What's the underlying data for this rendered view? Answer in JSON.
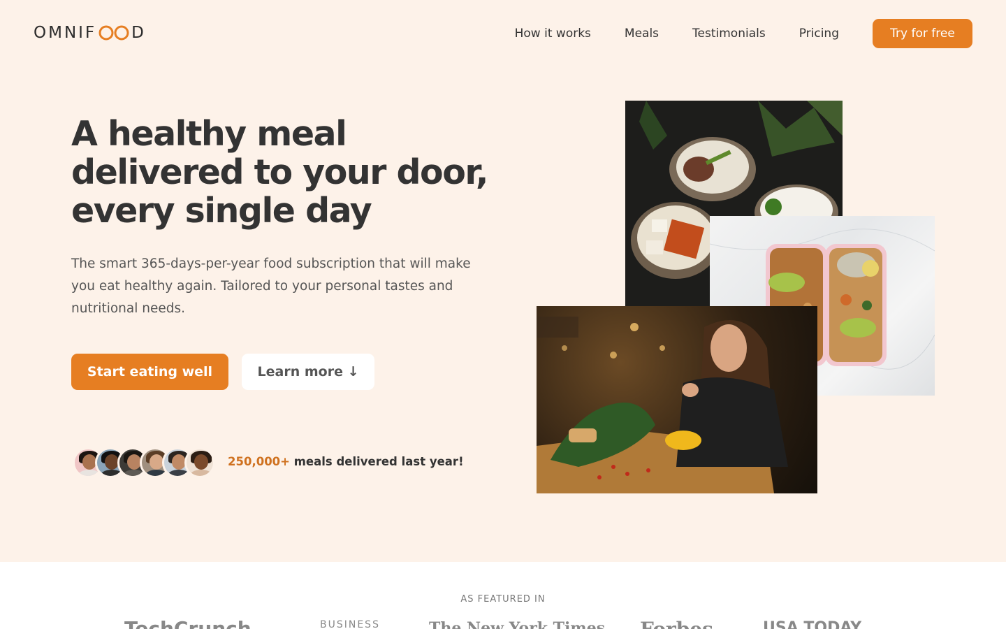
{
  "brand": {
    "name_left": "OMNIF",
    "name_right": "D",
    "accent": "#e67e22"
  },
  "nav": {
    "links": [
      "How it works",
      "Meals",
      "Testimonials",
      "Pricing"
    ],
    "cta": "Try for free"
  },
  "hero": {
    "headline": "A healthy meal delivered to your door, every single day",
    "description": "The smart 365-days-per-year food subscription that will make you eat healthy again. Tailored to your personal tastes and nutritional needs.",
    "primary_button": "Start eating well",
    "secondary_button": "Learn more ↓",
    "delivered_count": "250,000+",
    "delivered_text": " meals delivered last year!"
  },
  "featured": {
    "label": "AS FEATURED IN",
    "logos": [
      "TechCrunch",
      "BUSINESS",
      "The New York Times",
      "Forbes",
      "USA TODAY"
    ]
  },
  "colors": {
    "background": "#fdf2e9",
    "primary": "#e67e22",
    "text": "#333333"
  }
}
